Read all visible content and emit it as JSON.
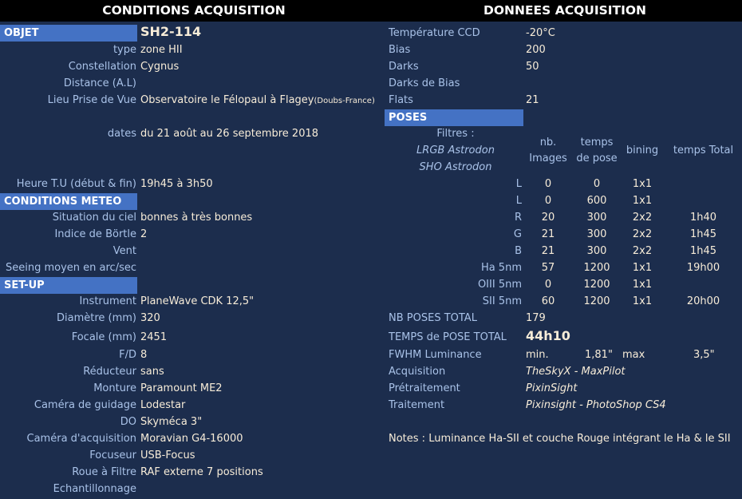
{
  "headers": {
    "left": "CONDITIONS ACQUISITION",
    "right": "DONNEES ACQUISITION"
  },
  "sections": {
    "objet": "OBJET",
    "meteo": "CONDITIONS METEO",
    "setup": "SET-UP",
    "poses": "POSES"
  },
  "objet": {
    "name": "SH2-114",
    "type_label": "type",
    "type": "zone HII",
    "constellation_label": "Constellation",
    "constellation": "Cygnus",
    "distance_label": "Distance (A.L)",
    "lieu_label": "Lieu Prise de Vue",
    "lieu": "Observatoire le Félopaul à Flagey",
    "lieu_suffix": "(Doubs-France)",
    "dates_label": "dates",
    "dates": "du 21 août au 26 septembre  2018",
    "heure_label": "Heure T.U (début & fin)",
    "heure": "19h45 à 3h50"
  },
  "meteo": {
    "ciel_label": "Situation du ciel",
    "ciel": "bonnes à très bonnes",
    "bortle_label": "Indice de Börtle",
    "bortle": "2",
    "vent_label": "Vent",
    "seeing_label": "Seeing moyen en arc/sec"
  },
  "setup": [
    {
      "label": "Instrument",
      "value": "PlaneWave CDK 12,5\""
    },
    {
      "label": "Diamètre (mm)",
      "value": "320"
    },
    {
      "label": "Focale (mm)",
      "value": "2451"
    },
    {
      "label": "F/D",
      "value": "8"
    },
    {
      "label": "Réducteur",
      "value": "sans"
    },
    {
      "label": "Monture",
      "value": "Paramount ME2"
    },
    {
      "label": "Caméra de guidage",
      "value": "Lodestar"
    },
    {
      "label": "DO",
      "value": "Skyméca 3\""
    },
    {
      "label": "Caméra d'acquisition",
      "value": "Moravian G4-16000"
    },
    {
      "label": "Focuseur",
      "value": "USB-Focus"
    },
    {
      "label": "Roue à Filtre",
      "value": "RAF externe 7 positions"
    },
    {
      "label": "Echantillonnage",
      "value": ""
    }
  ],
  "donnees": {
    "temp_label": "Température CCD",
    "temp": "-20°C",
    "bias_label": "Bias",
    "bias": "200",
    "darks_label": "Darks",
    "darks": "50",
    "darksbias_label": "Darks de Bias",
    "flats_label": "Flats",
    "flats": "21"
  },
  "poses": {
    "filtres_label": "Filtres :",
    "filtre_lrgb": "LRGB Astrodon",
    "filtre_sho": "SHO Astrodon",
    "col_nb_1": "nb.",
    "col_nb_2": "Images",
    "col_temps_1": "temps",
    "col_temps_2": "de pose",
    "col_bining": "bining",
    "col_total": "temps Total",
    "rows": [
      {
        "filter": "L",
        "nb": "0",
        "pose": "0",
        "bin": "1x1",
        "total": ""
      },
      {
        "filter": "L",
        "nb": "0",
        "pose": "600",
        "bin": "1x1",
        "total": ""
      },
      {
        "filter": "R",
        "nb": "20",
        "pose": "300",
        "bin": "2x2",
        "total": "1h40"
      },
      {
        "filter": "G",
        "nb": "21",
        "pose": "300",
        "bin": "2x2",
        "total": "1h45"
      },
      {
        "filter": "B",
        "nb": "21",
        "pose": "300",
        "bin": "2x2",
        "total": "1h45"
      },
      {
        "filter": "Ha 5nm",
        "nb": "57",
        "pose": "1200",
        "bin": "1x1",
        "total": "19h00"
      },
      {
        "filter": "OIII 5nm",
        "nb": "0",
        "pose": "1200",
        "bin": "1x1",
        "total": ""
      },
      {
        "filter": "SII 5nm",
        "nb": "60",
        "pose": "1200",
        "bin": "1x1",
        "total": "20h00"
      }
    ],
    "nb_total_label": "NB POSES TOTAL",
    "nb_total": "179",
    "temps_total_label": "TEMPS de POSE TOTAL",
    "temps_total": "44h10",
    "fwhm_label": "FWHM Luminance",
    "fwhm_min_label": "min.",
    "fwhm_min": "1,81\"",
    "fwhm_max_label": "max",
    "fwhm_max": "3,5\"",
    "acq_label": "Acquisition",
    "acq": "TheSkyX - MaxPilot",
    "pre_label": "Prétraitement",
    "pre": "PixinSight",
    "trait_label": "Traitement",
    "trait": "Pixinsight - PhotoShop CS4",
    "notes": "Notes :  Luminance Ha-SII et couche Rouge intégrant le Ha & le SII"
  }
}
